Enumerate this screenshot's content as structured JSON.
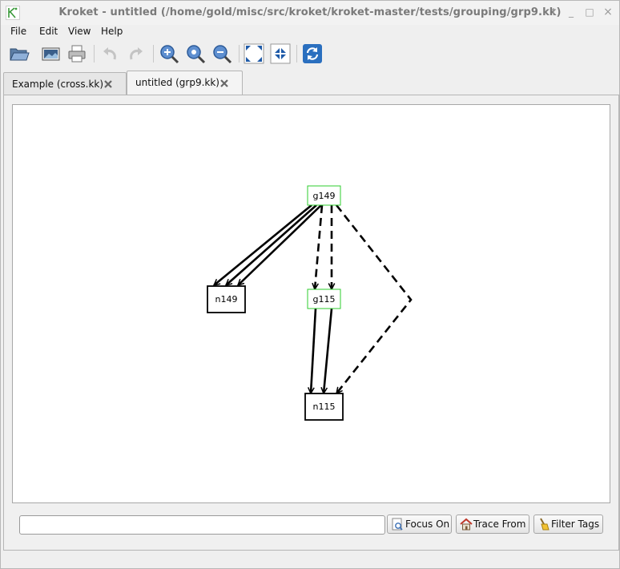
{
  "window": {
    "title": "Kroket - untitled (/home/gold/misc/src/kroket/kroket-master/tests/grouping/grp9.kk)",
    "controls": [
      "↑",
      "_",
      "□",
      "×"
    ]
  },
  "menu": [
    "File",
    "Edit",
    "View",
    "Help"
  ],
  "toolbar": {
    "buttons": [
      "open-icon",
      "export-image-icon",
      "print-icon",
      "undo-icon",
      "redo-icon",
      "zoom-in-icon",
      "zoom-fit-icon",
      "zoom-out-icon",
      "fullscreen-icon",
      "fit-selection-icon",
      "refresh-icon"
    ]
  },
  "tabs": [
    {
      "label": "Example (cross.kk)",
      "active": false
    },
    {
      "label": "untitled (grp9.kk)",
      "active": true
    }
  ],
  "graph": {
    "nodes": [
      {
        "id": "g149",
        "label": "g149",
        "kind": "group",
        "color": "#2ecc2e"
      },
      {
        "id": "n149",
        "label": "n149",
        "kind": "node",
        "color": "#000000"
      },
      {
        "id": "g115",
        "label": "g115",
        "kind": "group",
        "color": "#2ecc2e"
      },
      {
        "id": "n115",
        "label": "n115",
        "kind": "node",
        "color": "#000000"
      }
    ],
    "edges": [
      {
        "from": "g149",
        "to": "n149",
        "style": "solid"
      },
      {
        "from": "g149",
        "to": "n149",
        "style": "solid"
      },
      {
        "from": "g149",
        "to": "n149",
        "style": "solid"
      },
      {
        "from": "g149",
        "to": "g115",
        "style": "dashed"
      },
      {
        "from": "g149",
        "to": "g115",
        "style": "dashed"
      },
      {
        "from": "g149",
        "to": "n115",
        "style": "dashed"
      },
      {
        "from": "g115",
        "to": "n115",
        "style": "solid"
      },
      {
        "from": "g115",
        "to": "n115",
        "style": "solid"
      }
    ]
  },
  "bottom": {
    "search_value": "",
    "focus_on": "Focus On",
    "trace_from": "Trace From",
    "filter_tags": "Filter Tags"
  }
}
